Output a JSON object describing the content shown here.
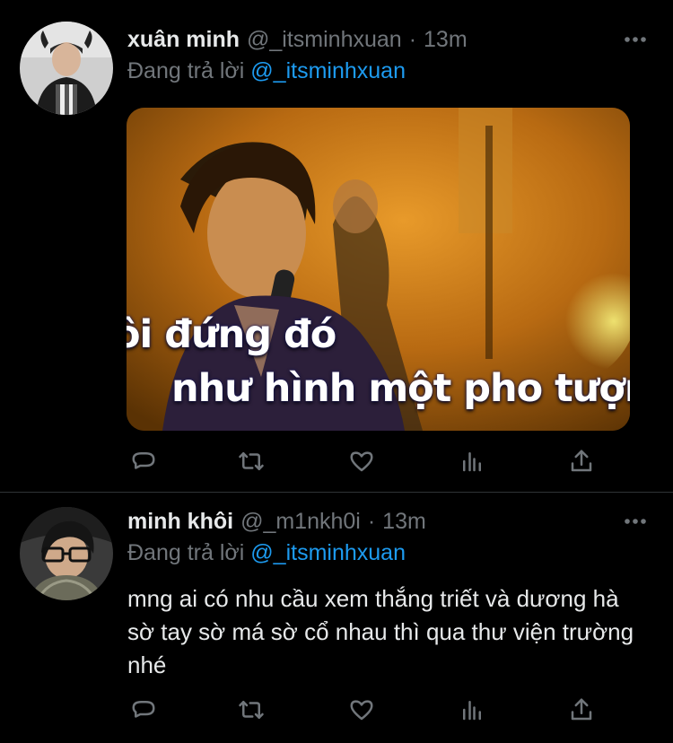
{
  "tweets": [
    {
      "display_name": "xuân minh",
      "handle": "@_itsminhxuan",
      "separator": "·",
      "time": "13m",
      "reply_prefix": "Đang trả lời",
      "reply_to": "@_itsminhxuan",
      "media_caption": [
        "ôi đứng đó",
        "như hình một pho tượn"
      ]
    },
    {
      "display_name": "minh khôi",
      "handle": "@_m1nkh0i",
      "separator": "·",
      "time": "13m",
      "reply_prefix": "Đang trả lời",
      "reply_to": "@_itsminhxuan",
      "text": "mng ai có nhu cầu xem thắng triết và dương hà sờ tay sờ má sờ cổ nhau thì qua thư viện trường nhé"
    }
  ],
  "icons": {
    "more": "more-horizontal-icon",
    "reply": "reply-icon",
    "retweet": "retweet-icon",
    "like": "heart-icon",
    "stats": "analytics-icon",
    "share": "share-icon"
  },
  "colors": {
    "background": "#000000",
    "primary_text": "#e7e9ea",
    "secondary_text": "#71767b",
    "accent": "#1d9bf0",
    "divider": "#2f3336"
  }
}
